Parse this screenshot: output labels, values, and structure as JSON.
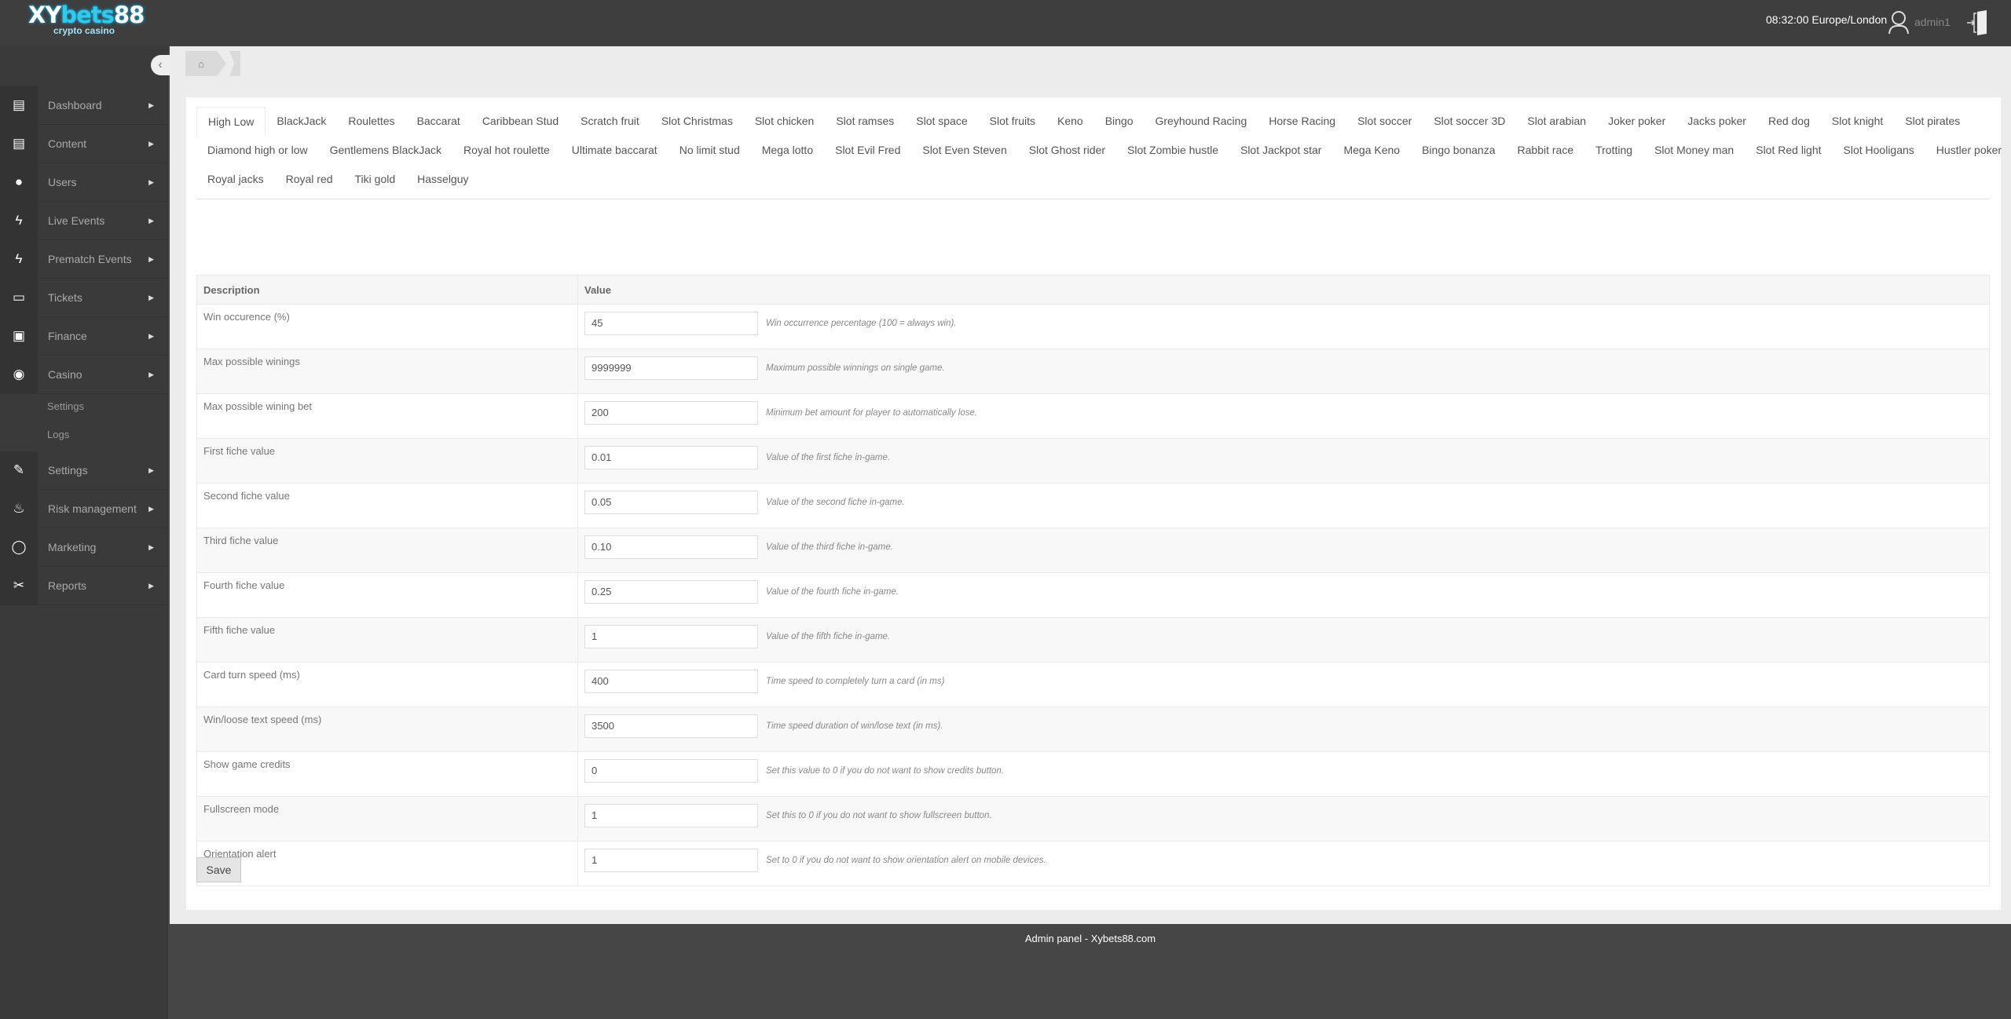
{
  "header": {
    "logo_main": "XYbets88",
    "logo_sub": "crypto casino",
    "clock": "08:32:00 Europe/London",
    "username": "admin1"
  },
  "sidebar": {
    "items": [
      {
        "label": "Dashboard",
        "icon": "book-icon",
        "glyph": "▤"
      },
      {
        "label": "Content",
        "icon": "book-icon",
        "glyph": "▤"
      },
      {
        "label": "Users",
        "icon": "user-icon",
        "glyph": "●"
      },
      {
        "label": "Live Events",
        "icon": "bolt-icon",
        "glyph": "ϟ"
      },
      {
        "label": "Prematch Events",
        "icon": "bolt-icon",
        "glyph": "ϟ"
      },
      {
        "label": "Tickets",
        "icon": "file-icon",
        "glyph": "▭"
      },
      {
        "label": "Finance",
        "icon": "money-icon",
        "glyph": "▣"
      },
      {
        "label": "Casino",
        "icon": "play-circle-icon",
        "glyph": "◉"
      },
      {
        "label": "Settings",
        "icon": "wrench-icon",
        "glyph": "✎"
      },
      {
        "label": "Risk management",
        "icon": "fire-extinguisher-icon",
        "glyph": "♨"
      },
      {
        "label": "Marketing",
        "icon": "comment-icon",
        "glyph": "◯"
      },
      {
        "label": "Reports",
        "icon": "paperclip-icon",
        "glyph": "✂"
      }
    ],
    "casino_sub": [
      "Settings",
      "Logs"
    ]
  },
  "tabs": [
    [
      "High Low",
      "BlackJack",
      "Roulettes",
      "Baccarat",
      "Caribbean Stud",
      "Scratch fruit",
      "Slot Christmas",
      "Slot chicken",
      "Slot ramses",
      "Slot space",
      "Slot fruits",
      "Keno",
      "Bingo",
      "Greyhound Racing",
      "Horse Racing",
      "Slot soccer",
      "Slot soccer 3D",
      "Slot arabian",
      "Joker poker",
      "Jacks poker",
      "Red dog",
      "Slot knight",
      "Slot pirates"
    ],
    [
      "Diamond high or low",
      "Gentlemens BlackJack",
      "Royal hot roulette",
      "Ultimate baccarat",
      "No limit stud",
      "Mega lotto",
      "Slot Evil Fred",
      "Slot Even Steven",
      "Slot Ghost rider",
      "Slot Zombie hustle",
      "Slot Jackpot star",
      "Mega Keno",
      "Bingo bonanza",
      "Rabbit race",
      "Trotting",
      "Slot Money man",
      "Slot Red light",
      "Slot Hooligans",
      "Hustler poker"
    ],
    [
      "Royal jacks",
      "Royal red",
      "Tiki gold",
      "Hasselguy"
    ]
  ],
  "active_tab": "High Low",
  "table": {
    "headers": [
      "Description",
      "Value"
    ],
    "rows": [
      {
        "label": "Win occurence (%)",
        "value": "45",
        "hint": "Win occurrence percentage (100 = always win)."
      },
      {
        "label": "Max possible winings",
        "value": "9999999",
        "hint": "Maximum possible winnings on single game."
      },
      {
        "label": "Max possible wining bet",
        "value": "200",
        "hint": "Minimum bet amount for player to automatically lose."
      },
      {
        "label": "First fiche value",
        "value": "0.01",
        "hint": "Value of the first fiche in-game."
      },
      {
        "label": "Second fiche value",
        "value": "0.05",
        "hint": "Value of the second fiche in-game."
      },
      {
        "label": "Third fiche value",
        "value": "0.10",
        "hint": "Value of the third fiche in-game."
      },
      {
        "label": "Fourth fiche value",
        "value": "0.25",
        "hint": "Value of the fourth fiche in-game."
      },
      {
        "label": "Fifth fiche value",
        "value": "1",
        "hint": "Value of the fifth fiche in-game."
      },
      {
        "label": "Card turn speed (ms)",
        "value": "400",
        "hint": "Time speed to completely turn a card (in ms)"
      },
      {
        "label": "Win/loose text speed (ms)",
        "value": "3500",
        "hint": "Time speed duration of win/lose text (in ms)."
      },
      {
        "label": "Show game credits",
        "value": "0",
        "hint": "Set this value to 0 if you do not want to show credits button."
      },
      {
        "label": "Fullscreen mode",
        "value": "1",
        "hint": "Set this to 0 if you do not want to show fullscreen button."
      },
      {
        "label": "Orientation alert",
        "value": "1",
        "hint": "Set to 0 if you do not want to show orientation alert on mobile devices."
      }
    ]
  },
  "save_label": "Save",
  "footer": "Admin panel - Xybets88.com"
}
